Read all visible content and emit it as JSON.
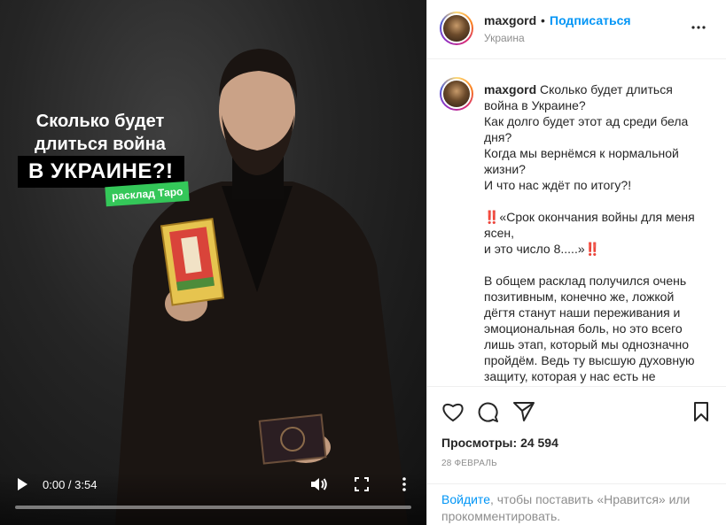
{
  "video": {
    "overlay": {
      "title": "Сколько будет длиться война",
      "badge": "В УКРАИНЕ?!",
      "tag": "расклад Таро"
    },
    "time": "0:00 / 3:54",
    "progress": 0.0
  },
  "header": {
    "username": "maxgord",
    "separator": "•",
    "follow_label": "Подписаться",
    "location": "Украина"
  },
  "post": {
    "username": "maxgord",
    "caption": "Сколько будет длиться война в Украине?\nКак долго будет этот ад среди бела дня?\nКогда мы вернёмся к нормальной жизни?\nИ что нас ждёт по итогу?!\n\n‼️«Срок окончания войны для меня ясен,\nи это число 8.....»‼️\n\nВ общем расклад получился очень позитивным, конечно же, ложкой дёгтя станут наши переживания и эмоциональная боль, но это всего лишь этап, который мы однозначно пройдём. Ведь ту высшую духовную защиту, которая у нас есть не",
    "views_label": "Просмотры:",
    "views_count": "24 594",
    "date": "28 ФЕВРАЛЬ"
  },
  "login": {
    "link": "Войдите",
    "rest": ", чтобы поставить «Нравится» или прокомментировать."
  },
  "icons": {
    "like": "heart-icon",
    "comment": "comment-icon",
    "share": "paper-plane-icon",
    "save": "bookmark-icon",
    "options": "more-horizontal-icon"
  },
  "colors": {
    "link": "#0095f6",
    "tag_green": "#34c759",
    "text": "#262626",
    "muted": "#8e8e8e"
  }
}
